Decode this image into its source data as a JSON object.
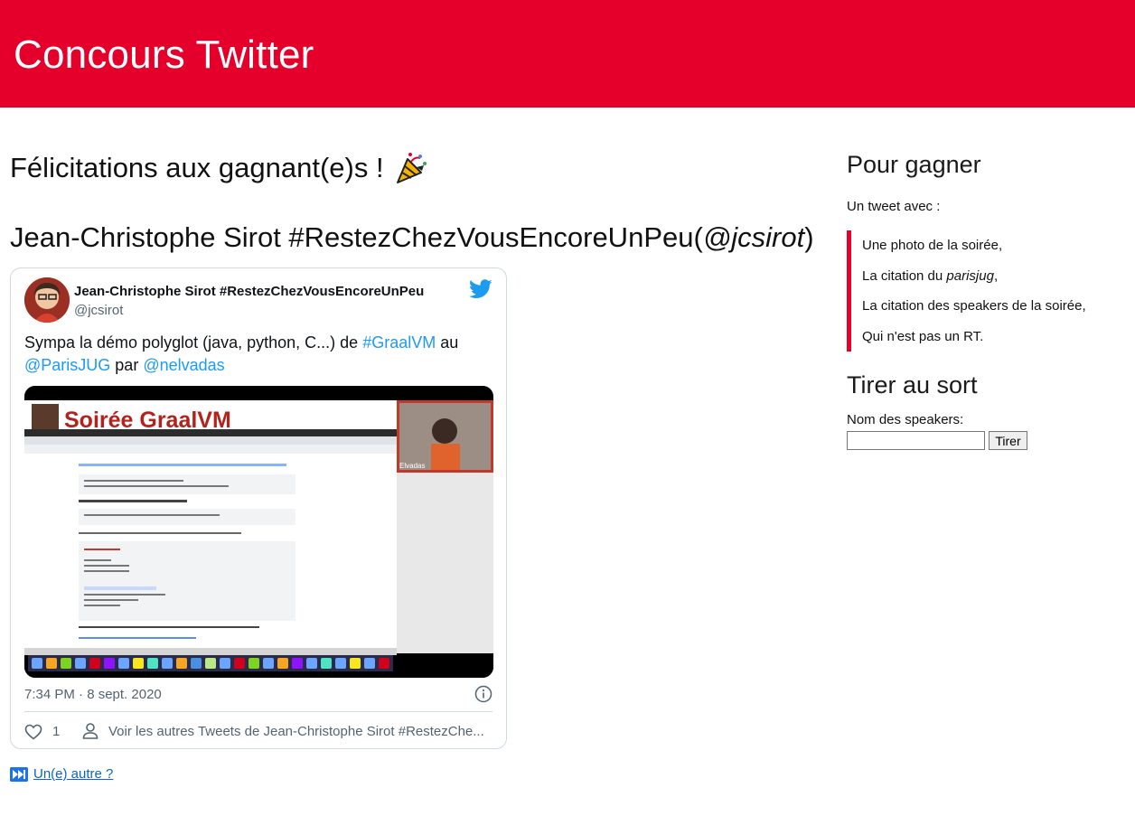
{
  "header": {
    "title": "Concours Twitter"
  },
  "main": {
    "congrats": "Félicitations aux gagnant(e)s !",
    "winner": {
      "name": "Jean-Christophe Sirot #RestezChezVousEncoreUnPeu",
      "open_paren": "(",
      "handle": "@jcsirot",
      "close_paren": ")"
    },
    "next_link": "Un(e) autre ?"
  },
  "tweet": {
    "author_name": "Jean-Christophe Sirot #RestezChezVousEncoreUnPeu",
    "author_handle": "@jcsirot",
    "text": {
      "part1": "Sympa la démo polyglot (java, python, C...) de ",
      "link1": "#GraalVM",
      "part2": " au ",
      "link2": "@ParisJUG",
      "part3": " par ",
      "link3": "@nelvadas"
    },
    "media": {
      "banner_title": "Soirée GraalVM",
      "speaker_label": "Elvadas"
    },
    "timestamp": "7:34 PM · 8 sept. 2020",
    "like_count": "1",
    "more_tweets": "Voir les autres Tweets de Jean-Christophe Sirot #RestezChe..."
  },
  "sidebar": {
    "how_to_win_title": "Pour gagner",
    "intro": "Un tweet avec :",
    "rules": {
      "r1": "Une photo de la soirée,",
      "r2_prefix": "La citation du ",
      "r2_em": "parisjug",
      "r2_suffix": ",",
      "r3": "La citation des speakers de la soirée,",
      "r4": "Qui n'est pas un RT."
    },
    "draw_title": "Tirer au sort",
    "draw_label": "Nom des speakers:",
    "draw_input_value": "",
    "draw_button": "Tirer"
  },
  "colors": {
    "brand": "#e4002b",
    "twitter_blue": "#1d9bf0"
  }
}
